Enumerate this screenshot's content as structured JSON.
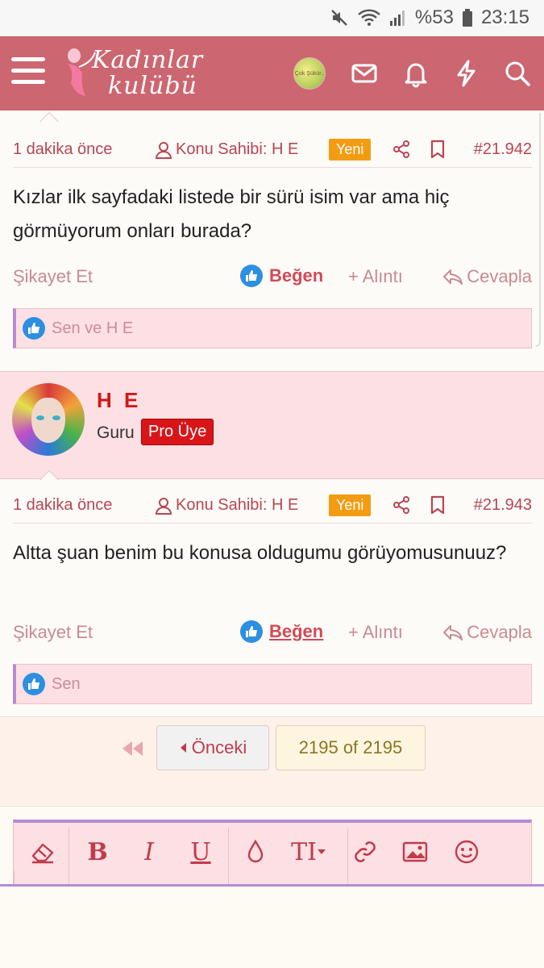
{
  "status_bar": {
    "battery_percent": "%53",
    "time": "23:15"
  },
  "header": {
    "logo_line1": "Kadınlar",
    "logo_line2": "kulübü",
    "avatar_text": "Çok Şükür.."
  },
  "posts": [
    {
      "time": "1 dakika önce",
      "author_label": "Konu Sahibi: H E",
      "badge": "Yeni",
      "number": "#21.942",
      "body": "Kızlar ilk sayfadaki listede bir sürü isim var ama hiç görmüyorum onları burada?",
      "report": "Şikayet Et",
      "like": "Beğen",
      "quote": "+ Alıntı",
      "reply": "Cevapla",
      "reactions": "Sen ve H E"
    },
    {
      "time": "1 dakika önce",
      "author_label": "Konu Sahibi: H E",
      "badge": "Yeni",
      "number": "#21.943",
      "body": "Altta şuan benim bu konusa oldugumu görüyomusunuuz?",
      "report": "Şikayet Et",
      "like": "Beğen",
      "quote": "+ Alıntı",
      "reply": "Cevapla",
      "reactions": "Sen"
    }
  ],
  "user": {
    "name": "H E",
    "title": "Guru",
    "badge": "Pro Üye"
  },
  "pagination": {
    "prev_label": "Önceki",
    "current": "2195 of 2195"
  },
  "editor": {
    "tools": [
      "eraser-icon",
      "bold",
      "italic",
      "underline",
      "color-drop-icon",
      "text-size-icon",
      "link-icon",
      "image-icon",
      "smiley-icon"
    ],
    "bold_label": "B",
    "italic_label": "I",
    "underline_label": "U",
    "size_label": "TI"
  },
  "colors": {
    "header": "#cc6670",
    "accent": "#c03c4c",
    "badge_new": "#f39c12",
    "pro_badge": "#d8161a",
    "reaction_bg": "#fde0e4",
    "like_blue": "#2d8fe0"
  }
}
